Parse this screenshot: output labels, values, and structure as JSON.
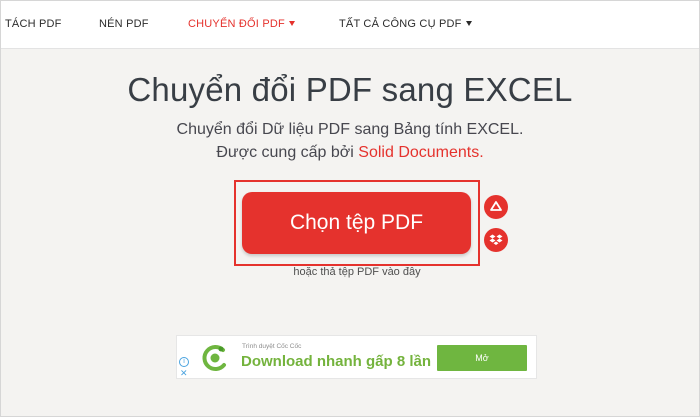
{
  "nav": {
    "items": [
      {
        "label": "TÁCH PDF"
      },
      {
        "label": "NÉN PDF"
      },
      {
        "label": "CHUYỂN ĐỔI PDF"
      },
      {
        "label": "TẤT CẢ CÔNG CỤ PDF"
      }
    ],
    "active_color": "#e5322d"
  },
  "hero": {
    "title": "Chuyển đổi PDF sang EXCEL",
    "subtitle_line1": "Chuyển đổi Dữ liệu PDF sang Bảng tính EXCEL.",
    "subtitle_line2_prefix": "Được cung cấp bởi",
    "subtitle_line2_link": "Solid Documents."
  },
  "upload": {
    "button_label": "Chọn tệp PDF",
    "drop_hint": "hoặc thả tệp PDF vào đây",
    "icons": [
      "google-drive-icon",
      "dropbox-icon"
    ]
  },
  "ad": {
    "small_text": "Trình duyệt Cốc Cốc",
    "headline": "Download nhanh gấp 8 lần",
    "cta_label": "Mở",
    "info_glyph": "i",
    "close_glyph": "✕",
    "brand_color": "#6fb640"
  },
  "colors": {
    "accent": "#e5322d",
    "background": "#f4f3f1"
  }
}
